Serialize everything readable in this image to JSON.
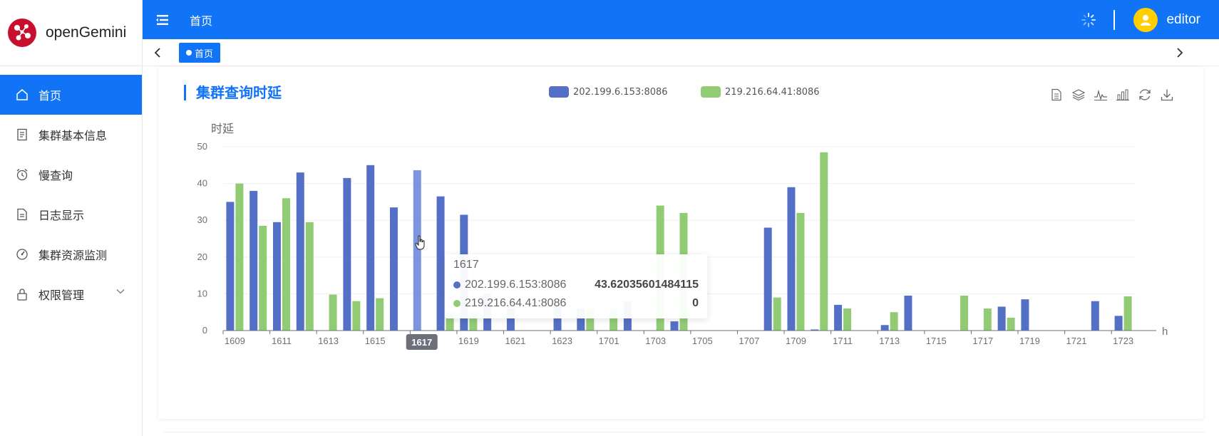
{
  "app": {
    "name": "openGemini",
    "user": "editor"
  },
  "header": {
    "title": "首页"
  },
  "tabs": [
    {
      "label": "首页"
    }
  ],
  "sidebar": {
    "items": [
      {
        "label": "首页",
        "icon": "home-icon",
        "active": true
      },
      {
        "label": "集群基本信息",
        "icon": "document-icon"
      },
      {
        "label": "慢查询",
        "icon": "alarm-clock-icon"
      },
      {
        "label": "日志显示",
        "icon": "log-icon"
      },
      {
        "label": "集群资源监测",
        "icon": "gauge-icon"
      },
      {
        "label": "权限管理",
        "icon": "lock-icon",
        "expandable": true
      }
    ]
  },
  "colors": {
    "primary": "#1173f5",
    "series1": "#5470c6",
    "series2": "#91cc75",
    "highlight": "#7b95e0"
  },
  "chart_data": {
    "type": "bar",
    "title": "集群查询时延",
    "ylabel": "时延",
    "xlabel": "h",
    "ylim": [
      0,
      50
    ],
    "yticks": [
      0,
      10,
      20,
      30,
      40,
      50
    ],
    "categories": [
      "1609",
      "1610",
      "1611",
      "1612",
      "1613",
      "1614",
      "1615",
      "1616",
      "1617",
      "1618",
      "1619",
      "1620",
      "1621",
      "1622",
      "1623",
      "1700",
      "1701",
      "1702",
      "1703",
      "1704",
      "1705",
      "1706",
      "1707",
      "1708",
      "1709",
      "1710",
      "1711",
      "1712",
      "1713",
      "1714",
      "1715",
      "1716",
      "1717",
      "1718",
      "1719",
      "1720",
      "1721",
      "1722",
      "1723"
    ],
    "xtick_labels": [
      "1609",
      "1611",
      "1613",
      "1615",
      "1617",
      "1619",
      "1621",
      "1623",
      "1701",
      "1703",
      "1705",
      "1707",
      "1709",
      "1711",
      "1713",
      "1715",
      "1717",
      "1719",
      "1721",
      "1723"
    ],
    "legend_position": "top-center",
    "highlight_category": "1617",
    "series": [
      {
        "name": "202.199.6.153:8086",
        "values": [
          35,
          38,
          29.5,
          43,
          0,
          41.5,
          45,
          33.5,
          43.62035601484115,
          36.5,
          31.5,
          10,
          6,
          0,
          7,
          6,
          0,
          8,
          0,
          2.5,
          0,
          0,
          0,
          28,
          39,
          0.3,
          7,
          0,
          1.5,
          9.5,
          0,
          0,
          0,
          6.5,
          8.5,
          0,
          0,
          8,
          4
        ]
      },
      {
        "name": "219.216.64.41:8086",
        "values": [
          40,
          28.5,
          36,
          29.5,
          9.8,
          8,
          8.8,
          0,
          0,
          5,
          5,
          0,
          0,
          0,
          0,
          6,
          6,
          0,
          34,
          32,
          0,
          0,
          0,
          9,
          32,
          48.5,
          6,
          0,
          5,
          0,
          0,
          9.5,
          6,
          3.5,
          0,
          0,
          0,
          0,
          9.3
        ]
      }
    ]
  },
  "tooltip": {
    "title": "1617",
    "rows": [
      {
        "name": "202.199.6.153:8086",
        "value": "43.62035601484115"
      },
      {
        "name": "219.216.64.41:8086",
        "value": "0"
      }
    ]
  },
  "toolbox": [
    "data-view-icon",
    "stack-icon",
    "line-chart-icon",
    "bar-chart-icon",
    "refresh-icon",
    "download-icon"
  ]
}
